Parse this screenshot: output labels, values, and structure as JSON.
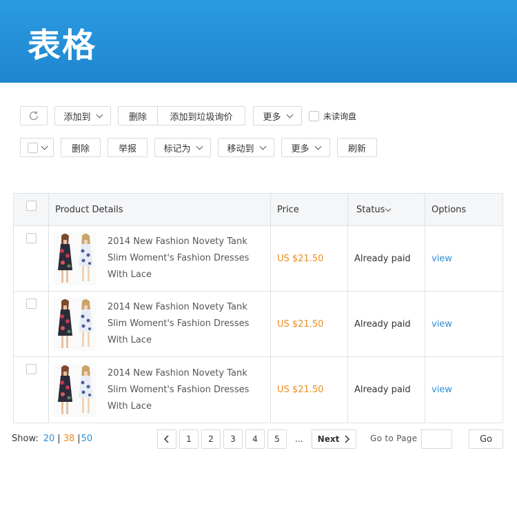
{
  "header": {
    "title": "表格"
  },
  "toolbar1": {
    "add_to": "添加到",
    "delete": "删除",
    "add_to_spam": "添加到垃圾询价",
    "more": "更多",
    "unread": "未读询盘"
  },
  "toolbar2": {
    "delete": "删除",
    "report": "举报",
    "mark_as": "标记为",
    "move_to": "移动到",
    "more": "更多",
    "refresh": "刷新"
  },
  "table": {
    "columns": [
      "Product Details",
      "Price",
      "Status",
      "Options"
    ],
    "rows": [
      {
        "title": "2014 New Fashion Novety Tank Slim Woment's Fashion Dresses With Lace",
        "price": "US $21.50",
        "status": "Already paid",
        "option": "view"
      },
      {
        "title": "2014 New Fashion Novety Tank Slim Woment's Fashion Dresses With Lace",
        "price": "US $21.50",
        "status": "Already paid",
        "option": "view"
      },
      {
        "title": "2014 New Fashion Novety Tank Slim Woment's Fashion Dresses With Lace",
        "price": "US $21.50",
        "status": "Already paid",
        "option": "view"
      }
    ]
  },
  "footer": {
    "show_label": "Show:",
    "show_options": [
      "20",
      "38",
      "50"
    ],
    "pages": [
      "1",
      "2",
      "3",
      "4",
      "5"
    ],
    "ellipsis": "...",
    "next": "Next",
    "goto_label": "Go to Page",
    "go": "Go"
  },
  "colors": {
    "header": "#1f86cf",
    "price": "#f08a1e",
    "link": "#2b8fd6",
    "show_active": "#f08a1e"
  },
  "icons": [
    "refresh-icon",
    "chevron-down-icon",
    "chevron-left-icon",
    "chevron-right-icon",
    "sort-down-icon"
  ]
}
